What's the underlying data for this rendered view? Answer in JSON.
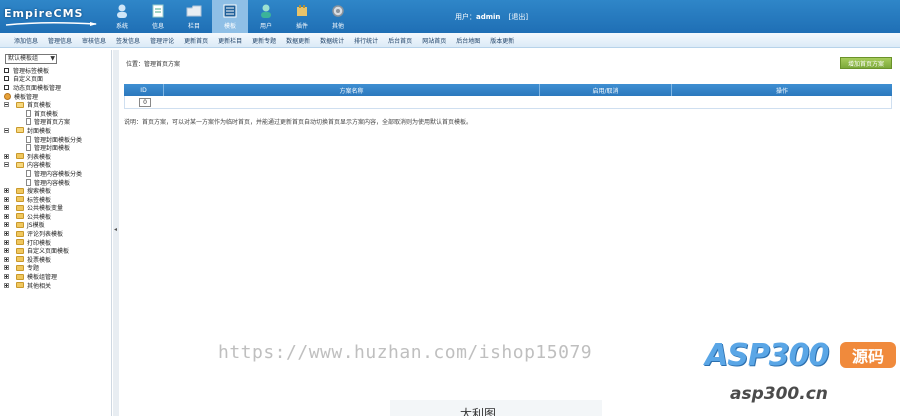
{
  "header": {
    "logo": "EmpireCMS",
    "nav": [
      {
        "label": "系统",
        "icon": "user-group-icon",
        "active": false
      },
      {
        "label": "信息",
        "icon": "document-icon",
        "active": false
      },
      {
        "label": "栏目",
        "icon": "folder-icon",
        "active": false
      },
      {
        "label": "模板",
        "icon": "template-icon",
        "active": true
      },
      {
        "label": "用户",
        "icon": "user-icon",
        "active": false
      },
      {
        "label": "插件",
        "icon": "plugin-icon",
        "active": false
      },
      {
        "label": "其他",
        "icon": "gear-icon",
        "active": false
      }
    ],
    "user_prefix": "用户：",
    "username": "admin",
    "logout": "[退出]"
  },
  "subnav": [
    "添加信息",
    "管理信息",
    "审核信息",
    "签发信息",
    "管理评论",
    "更新首页",
    "更新栏目",
    "更新专题",
    "数据更新",
    "数据统计",
    "排行统计",
    "后台首页",
    "网站首页",
    "后台地图",
    "版本更新"
  ],
  "sidebar": {
    "select_value": "默认模板组",
    "items": [
      {
        "type": "square",
        "label": "管理标签模板"
      },
      {
        "type": "square",
        "label": "自定义页面"
      },
      {
        "type": "square",
        "label": "动态页面模板管理"
      },
      {
        "type": "root",
        "label": "模板管理"
      },
      {
        "type": "folder-open",
        "label": "首页模板"
      },
      {
        "type": "doc",
        "label": "首页模板"
      },
      {
        "type": "doc",
        "label": "管理首页方案"
      },
      {
        "type": "folder-open",
        "label": "封面模板"
      },
      {
        "type": "doc",
        "label": "管理封面模板分类"
      },
      {
        "type": "doc",
        "label": "管理封面模板"
      },
      {
        "type": "folder",
        "label": "列表模板"
      },
      {
        "type": "folder-open",
        "label": "内容模板"
      },
      {
        "type": "doc",
        "label": "管理内容模板分类"
      },
      {
        "type": "doc",
        "label": "管理内容模板"
      },
      {
        "type": "folder",
        "label": "搜索模板"
      },
      {
        "type": "folder",
        "label": "标签模板"
      },
      {
        "type": "folder",
        "label": "公共模板变量"
      },
      {
        "type": "folder",
        "label": "公共模板"
      },
      {
        "type": "folder",
        "label": "JS模板"
      },
      {
        "type": "folder",
        "label": "评论列表模板"
      },
      {
        "type": "folder",
        "label": "打印模板"
      },
      {
        "type": "folder",
        "label": "自定义页面模板"
      },
      {
        "type": "folder",
        "label": "投票模板"
      },
      {
        "type": "folder",
        "label": "专题"
      },
      {
        "type": "folder",
        "label": "模板组管理"
      },
      {
        "type": "folder",
        "label": "其他相关"
      }
    ]
  },
  "main": {
    "location": "位置：管理首页方案",
    "add_button": "增加首页方案",
    "columns": [
      "ID",
      "方案名称",
      "启用/取消",
      "操作"
    ],
    "rows": [
      {
        "id": "0",
        "name": "",
        "toggle": "",
        "ops": ""
      }
    ],
    "note": "说明：首页方案，可以对某一方案作为临时首页，并能通过更新首页自动切换首页显示方案内容，全部取消则为使用默认首页模板。"
  },
  "watermark": {
    "url": "https://www.huzhan.com/ishop15079",
    "brand": "ASP300",
    "badge": "源码",
    "domain": "asp300.cn",
    "bottom": "太利图"
  },
  "colors": {
    "header": "#2f86c8",
    "table_head": "#3f8fd2",
    "add_button": "#8ab848"
  }
}
